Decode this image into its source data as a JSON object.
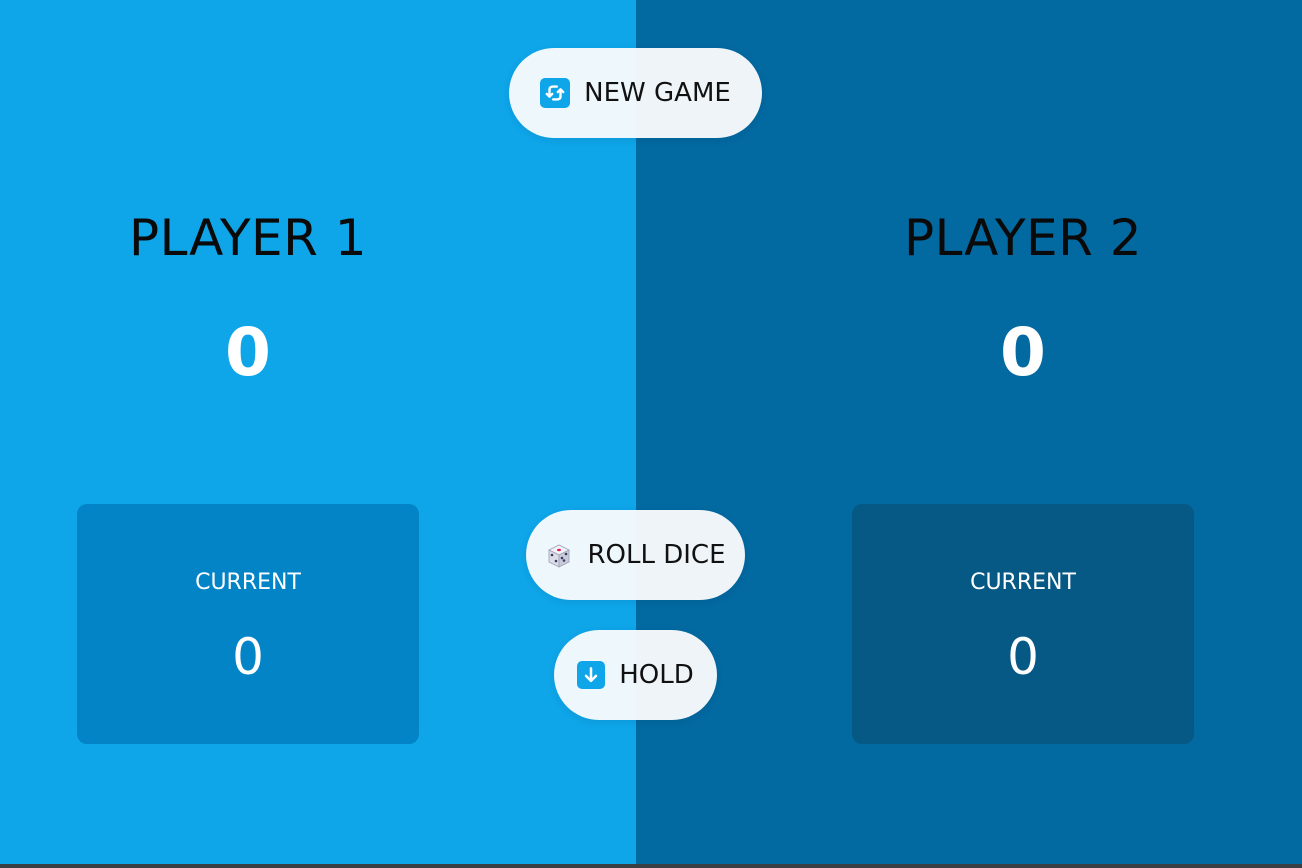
{
  "controls": {
    "new_game": {
      "label": "NEW GAME",
      "icon": "refresh-icon"
    },
    "roll_dice": {
      "label": "ROLL DICE",
      "icon": "dice-icon"
    },
    "hold": {
      "label": "HOLD",
      "icon": "arrow-down-icon"
    }
  },
  "players": [
    {
      "name": "PLAYER 1",
      "score": "0",
      "current_label": "CURRENT",
      "current_score": "0"
    },
    {
      "name": "PLAYER 2",
      "score": "0",
      "current_label": "CURRENT",
      "current_score": "0"
    }
  ],
  "colors": {
    "player1_bg": "#0ea5e9",
    "player2_bg": "#0369a1",
    "player1_current_bg": "#0284c7",
    "player2_current_bg": "#075985",
    "button_bg": "#f8fafc",
    "icon_accent": "#0ea5e9"
  }
}
